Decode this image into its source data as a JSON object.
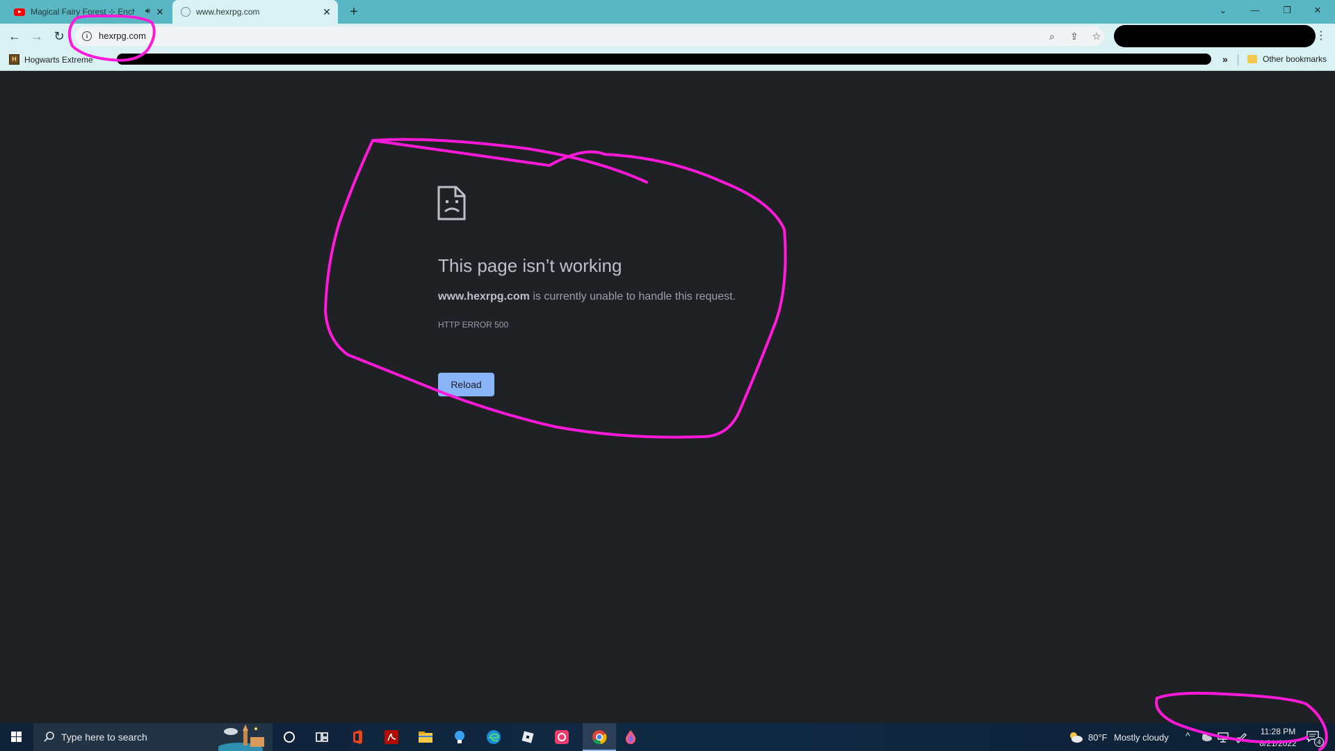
{
  "browser": {
    "tabs": [
      {
        "title": "Magical Fairy Forest ⊹ Encha",
        "icon": "youtube-icon",
        "audio": true
      },
      {
        "title": "www.hexrpg.com",
        "icon": "globe-icon",
        "active": true
      }
    ],
    "new_tab": "+",
    "window_controls": [
      "⌄",
      "—",
      "❐",
      "✕"
    ],
    "address_bar": {
      "url": "hexrpg.com"
    },
    "bookmarks": {
      "items": [
        {
          "label": "Hogwarts Extreme",
          "icon": "hogwarts-icon"
        }
      ],
      "overflow": "»",
      "other_bookmarks": "Other bookmarks"
    }
  },
  "error_page": {
    "title": "This page isn’t working",
    "domain": "www.hexrpg.com",
    "description": " is currently unable to handle this request.",
    "error_code": "HTTP ERROR 500",
    "reload_label": "Reload"
  },
  "taskbar": {
    "search_placeholder": "Type here to search",
    "weather": {
      "temp": "80°F",
      "condition": "Mostly cloudy"
    },
    "clock": {
      "time": "11:28 PM",
      "date": "8/21/2022"
    },
    "notifications": "4"
  },
  "colors": {
    "chrome_frame": "#59b6c3",
    "chrome_toolbar": "#d9f1f3",
    "page_bg": "#202124",
    "reload_button": "#8ab4f8",
    "annotation": "#ff1ad9"
  }
}
